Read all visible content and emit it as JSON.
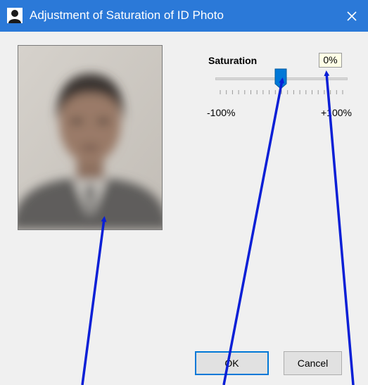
{
  "window": {
    "title": "Adjustment of Saturation of ID Photo",
    "titlebar_color": "#2b79d8",
    "app_icon": "person-silhouette-icon",
    "close_icon": "close-icon"
  },
  "photo": {
    "description_icon": "id-photo-preview"
  },
  "saturation": {
    "label": "Saturation",
    "value_text": "0%",
    "value": 0,
    "min_label": "-100%",
    "max_label": "+100%",
    "accent_color": "#0078d7"
  },
  "buttons": {
    "ok_label": "OK",
    "cancel_label": "Cancel"
  },
  "annotations": {
    "arrow_color": "#0a1fd6"
  }
}
